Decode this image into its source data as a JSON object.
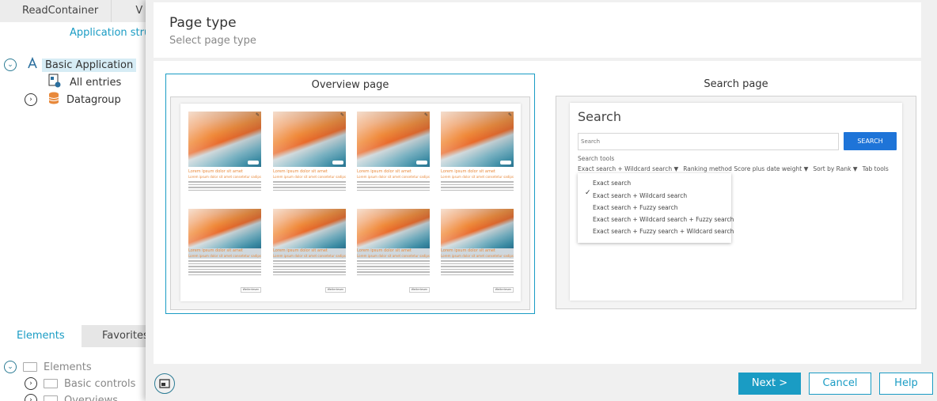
{
  "background": {
    "tabs": [
      "ReadContainer",
      "V"
    ],
    "structure_link": "Application struc",
    "tree": {
      "root": "Basic Application",
      "children": [
        "All entries",
        "Datagroup"
      ]
    },
    "bottom_tabs": {
      "active": "Elements",
      "inactive": "Favorites"
    },
    "elements": [
      "Elements",
      "Basic controls",
      "Overviews"
    ]
  },
  "dialog": {
    "title": "Page type",
    "subtitle": "Select page type",
    "options": [
      {
        "label": "Overview page",
        "selected": true
      },
      {
        "label": "Search page",
        "selected": false
      }
    ],
    "overview_preview": {
      "card_title": "Lorem ipsum dolor sit amet",
      "card_subtitle": "Lorem ipsum dolor sit amet consetetur sadipscing",
      "row2_title": "Lorem ipsum dolor sit amet",
      "button": "Weiterlesen"
    },
    "search_preview": {
      "title": "Search",
      "input_placeholder": "Search",
      "button": "SEARCH",
      "tools_label": "Search tools",
      "tool_items": [
        "Exact search + Wildcard search ▼",
        "Ranking method Score plus date weight ▼",
        "Sort by Rank ▼",
        "Tab tools"
      ],
      "dropdown": [
        "Exact search",
        "Exact search + Wildcard search",
        "Exact search + Fuzzy search",
        "Exact search + Wildcard search + Fuzzy search",
        "Exact search + Fuzzy search + Wildcard search"
      ],
      "checked_index": 1
    },
    "buttons": {
      "next": "Next >",
      "cancel": "Cancel",
      "help": "Help"
    }
  },
  "colors": {
    "accent": "#1a9cc4",
    "search_button": "#1e74d8",
    "orange_text": "#e8893b"
  }
}
